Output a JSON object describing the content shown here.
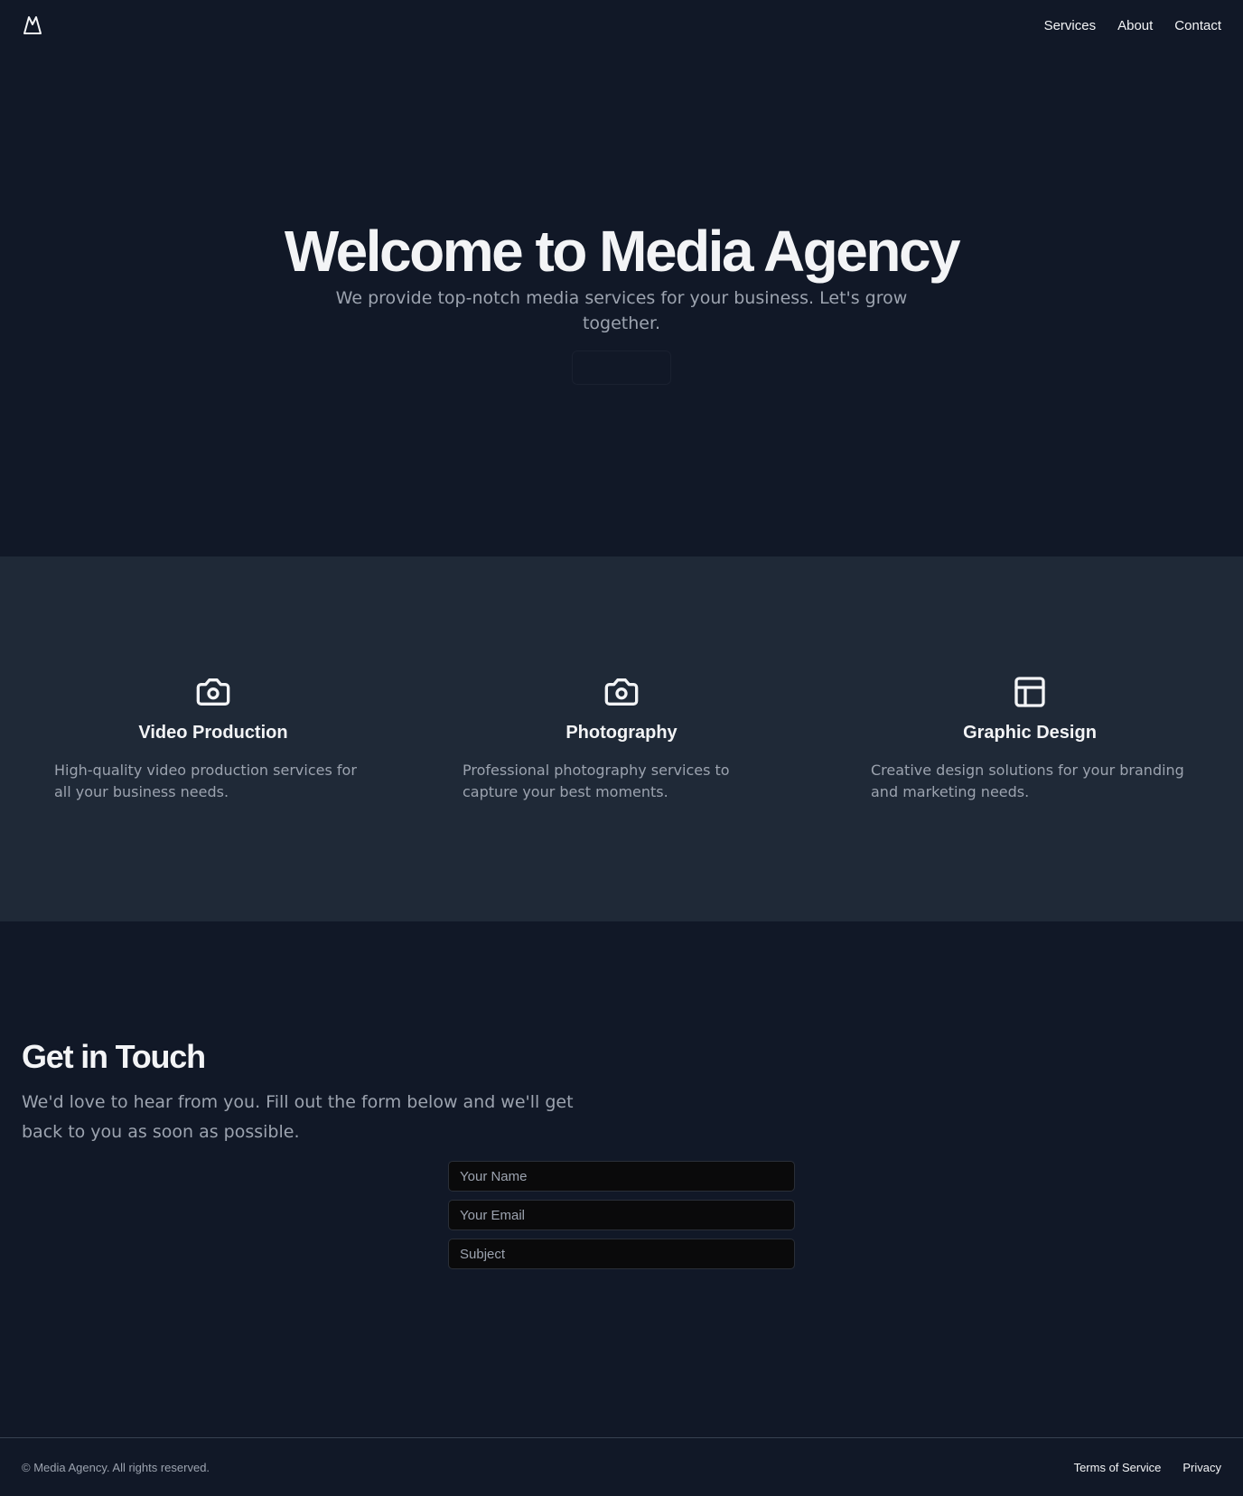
{
  "header": {
    "logo_icon": "mountain-icon",
    "nav": [
      {
        "label": "Services"
      },
      {
        "label": "About"
      },
      {
        "label": "Contact"
      }
    ]
  },
  "hero": {
    "title": "Welcome to Media Agency",
    "subtitle": "We provide top-notch media services for your business. Let's grow together.",
    "button_label": ""
  },
  "services": [
    {
      "icon": "camera-icon",
      "title": "Video Production",
      "description": "High-quality video production services for all your business needs."
    },
    {
      "icon": "camera-icon",
      "title": "Photography",
      "description": "Professional photography services to capture your best moments."
    },
    {
      "icon": "layout-icon",
      "title": "Graphic Design",
      "description": "Creative design solutions for your branding and marketing needs."
    }
  ],
  "contact": {
    "title": "Get in Touch",
    "subtitle": "We'd love to hear from you. Fill out the form below and we'll get back to you as soon as possible.",
    "fields": [
      {
        "placeholder": "Your Name",
        "value": ""
      },
      {
        "placeholder": "Your Email",
        "value": ""
      },
      {
        "placeholder": "Subject",
        "value": ""
      }
    ]
  },
  "footer": {
    "copyright": "© Media Agency. All rights reserved.",
    "links": [
      {
        "label": "Terms of Service"
      },
      {
        "label": "Privacy"
      }
    ]
  },
  "colors": {
    "background": "#111827",
    "section_background": "#1f2937",
    "text_primary": "#f3f4f6",
    "text_muted": "#9ca3af",
    "input_background": "#0a0a0b"
  }
}
